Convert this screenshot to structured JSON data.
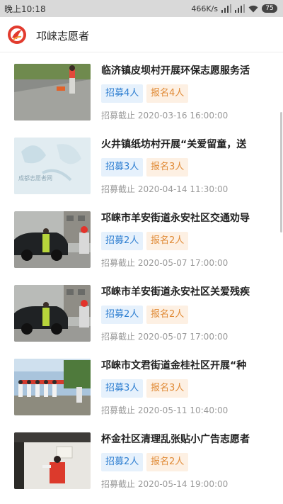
{
  "status_bar": {
    "time": "晚上10:18",
    "network_speed": "466K/s",
    "battery": "75"
  },
  "app_bar": {
    "title": "邛崃志愿者"
  },
  "items": [
    {
      "title": "临济镇皮坝村开展环保志愿服务活",
      "recruit": "招募4人",
      "signup": "报名4人",
      "deadline": "招募截止 2020-03-16 16:00:00",
      "thumb": "street-cleaning"
    },
    {
      "title": "火井镇纸坊村开展“关爱留童，送",
      "recruit": "招募3人",
      "signup": "报名3人",
      "deadline": "招募截止 2020-04-14 11:30:00",
      "thumb": "placeholder-watermark",
      "thumb_text": "成都志愿者网"
    },
    {
      "title": "邛崃市羊安街道永安社区交通劝导",
      "recruit": "招募2人",
      "signup": "报名2人",
      "deadline": "招募截止 2020-05-07 17:00:00",
      "thumb": "traffic-car"
    },
    {
      "title": "邛崃市羊安街道永安社区关爱残疾",
      "recruit": "招募2人",
      "signup": "报名2人",
      "deadline": "招募截止 2020-05-07 17:00:00",
      "thumb": "traffic-car"
    },
    {
      "title": "邛崃市文君街道金桂社区开展“种",
      "recruit": "招募3人",
      "signup": "报名3人",
      "deadline": "招募截止 2020-05-11 10:40:00",
      "thumb": "group-outdoor"
    },
    {
      "title": "杯金社区清理乱张贴小广告志愿者",
      "recruit": "招募2人",
      "signup": "报名2人",
      "deadline": "招募截止 2020-05-14 19:00:00",
      "thumb": "wall-cleaning"
    }
  ]
}
